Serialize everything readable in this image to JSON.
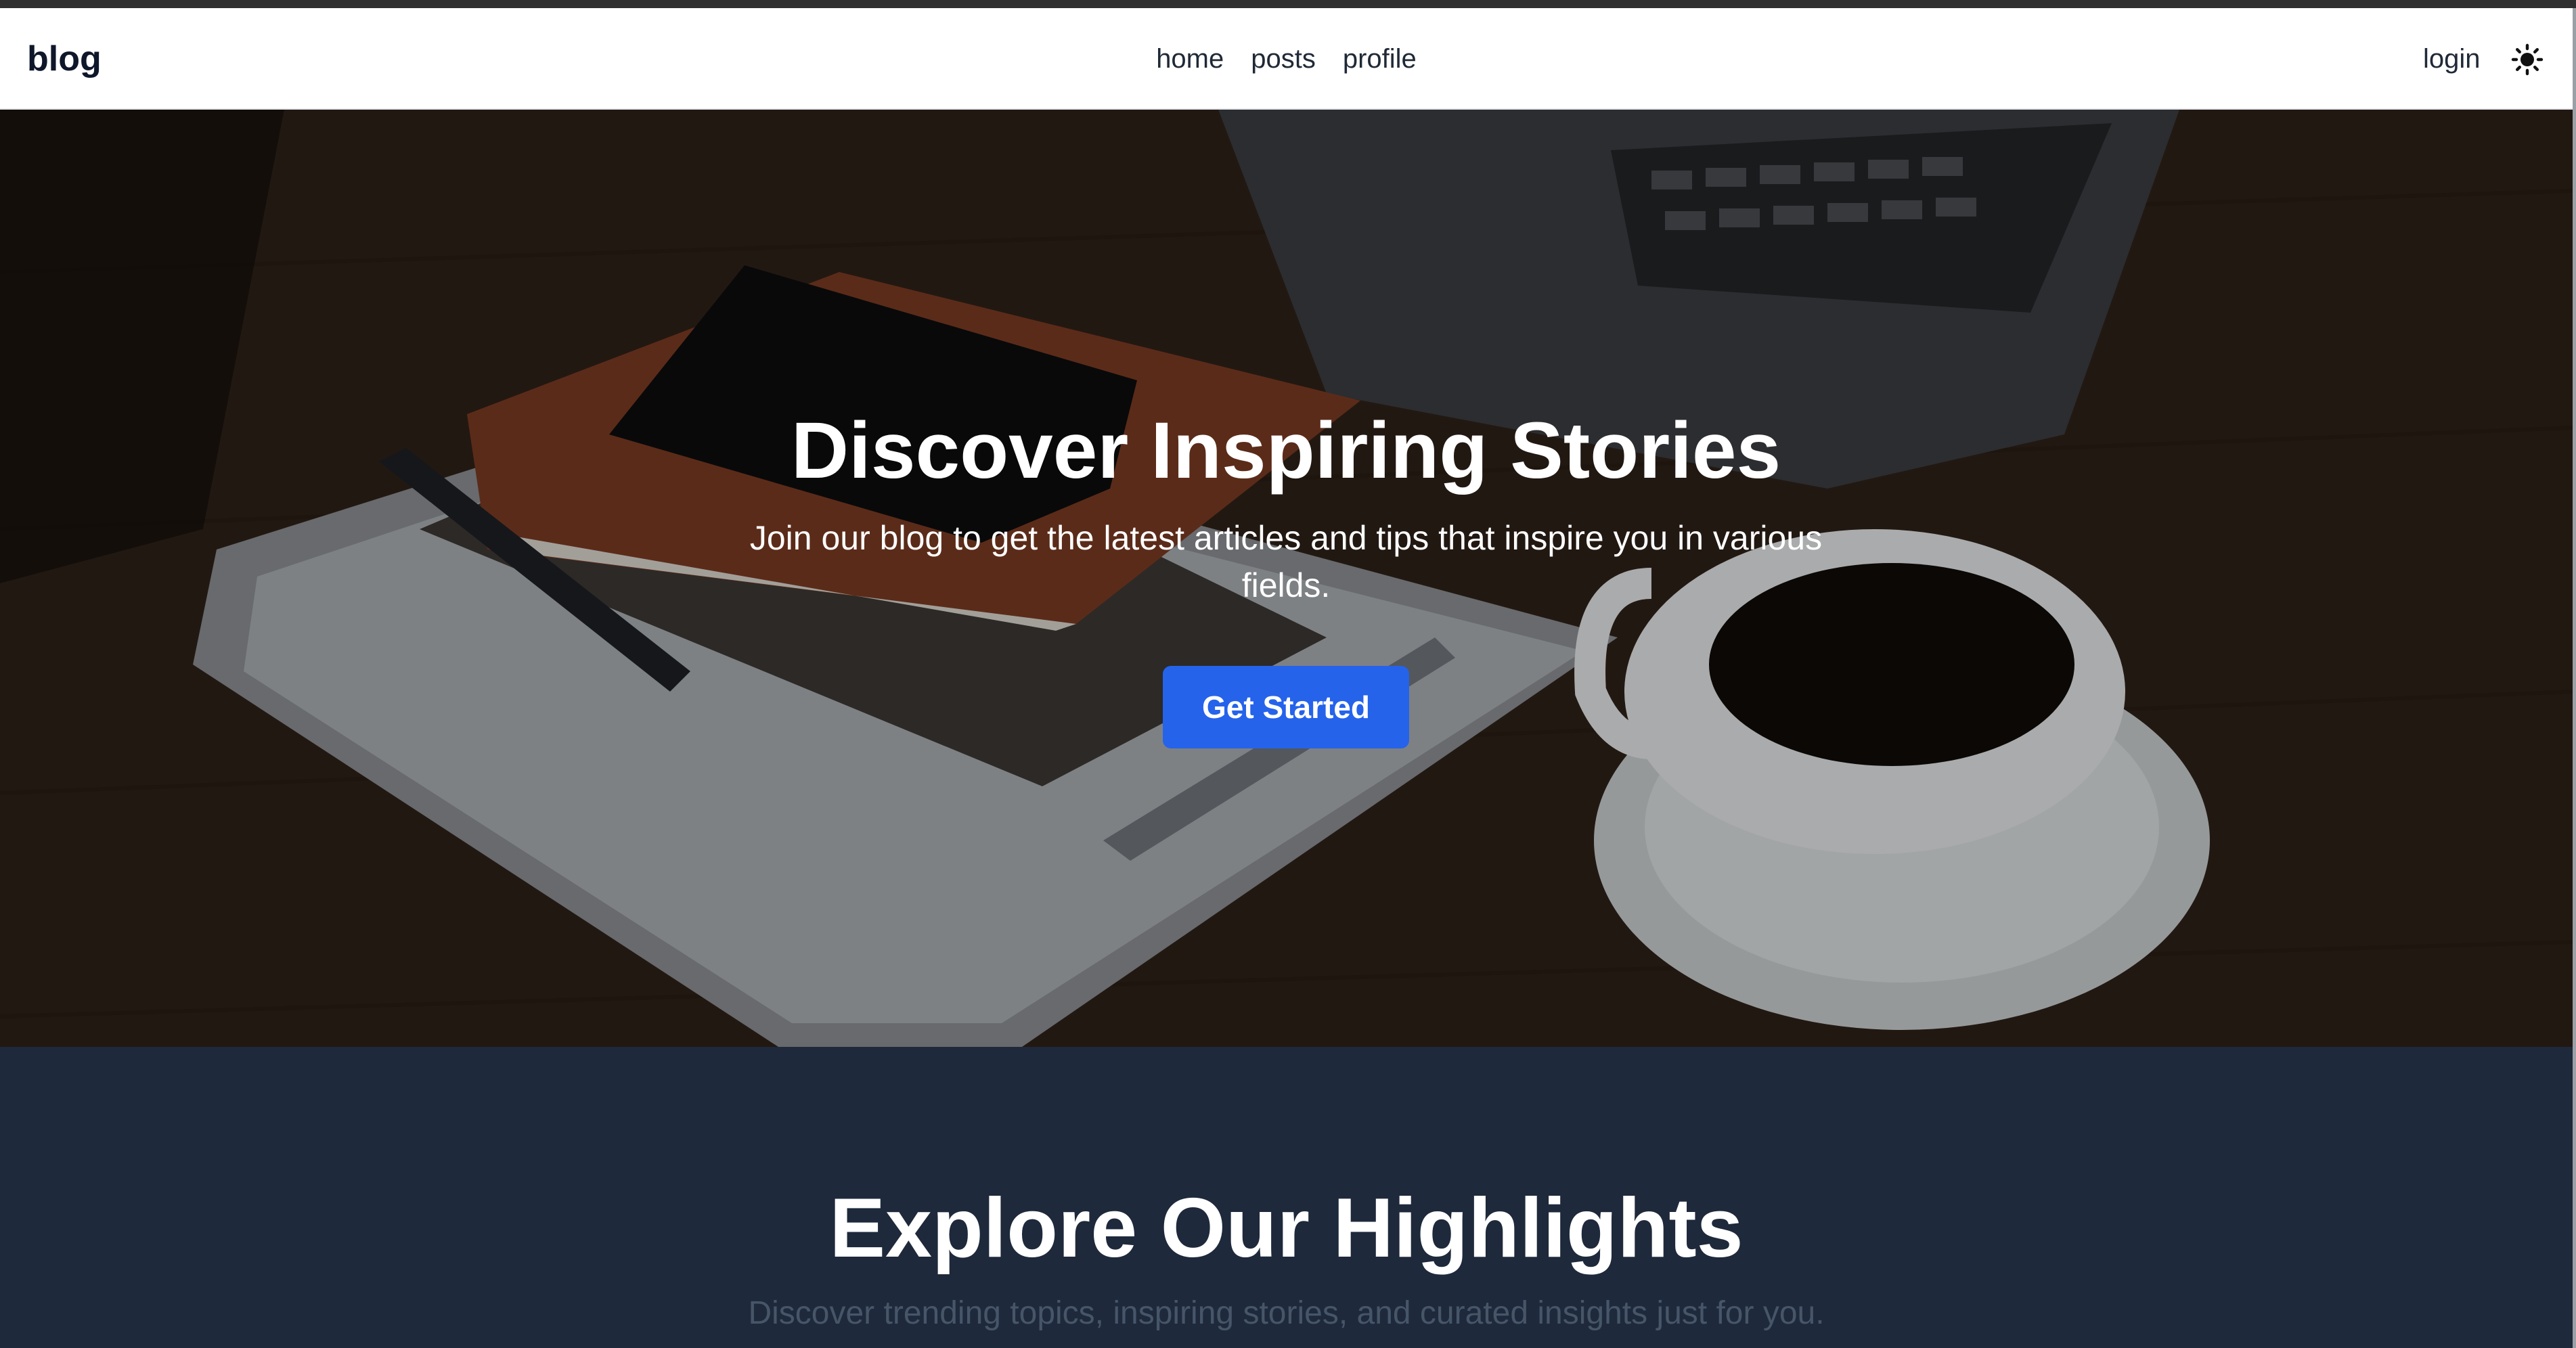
{
  "nav": {
    "brand": "blog",
    "links": [
      {
        "label": "home"
      },
      {
        "label": "posts"
      },
      {
        "label": "profile"
      }
    ],
    "login_label": "login",
    "theme_icon": "sun-icon"
  },
  "hero": {
    "title": "Discover Inspiring Stories",
    "subtitle": "Join our blog to get the latest articles and tips that inspire you in various fields.",
    "cta_label": "Get Started"
  },
  "highlights": {
    "title": "Explore Our Highlights",
    "subtitle": "Discover trending topics, inspiring stories, and curated insights just for you."
  },
  "colors": {
    "primary": "#2563eb",
    "dark_section": "#1e293b",
    "navbar_bg": "#ffffff",
    "text_dark": "#1f2937",
    "subtitle_muted": "#475569"
  }
}
